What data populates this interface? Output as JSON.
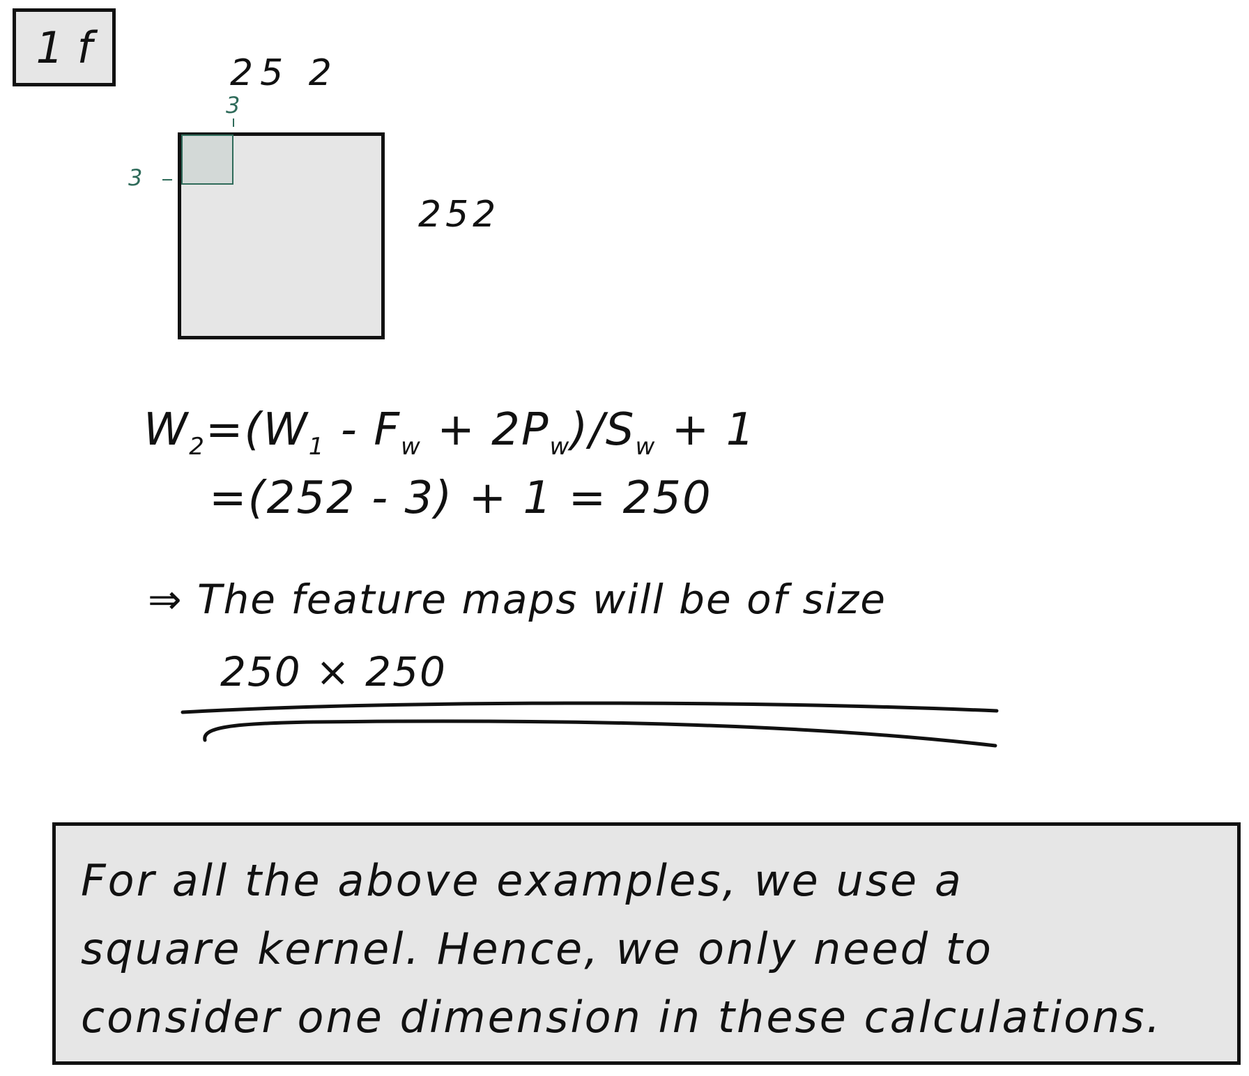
{
  "label": "1 f",
  "diagram": {
    "width_label": "25 2",
    "height_label": "252",
    "kernel_width_label": "3",
    "kernel_height_label": "3"
  },
  "formula": {
    "line1_W": "W",
    "line1_W_sub": "2",
    "line1_eq": "=(W",
    "line1_W1_sub": "1",
    "line1_minus_F": " - F",
    "line1_F_sub": "w",
    "line1_plus_2P": " + 2P",
    "line1_P_sub": "w",
    "line1_div_S": ")/S",
    "line1_S_sub": "w",
    "line1_plus_1": " + 1",
    "line2": "=(252 - 3) + 1 = 250"
  },
  "conclusion": {
    "line1": "⇒ The feature maps  will be of  size",
    "line2": "250 × 250"
  },
  "note": {
    "line1": "For all the above examples, we use a",
    "line2": "square kernel. Hence, we only need to",
    "line3": "consider one dimension in these calculations."
  }
}
